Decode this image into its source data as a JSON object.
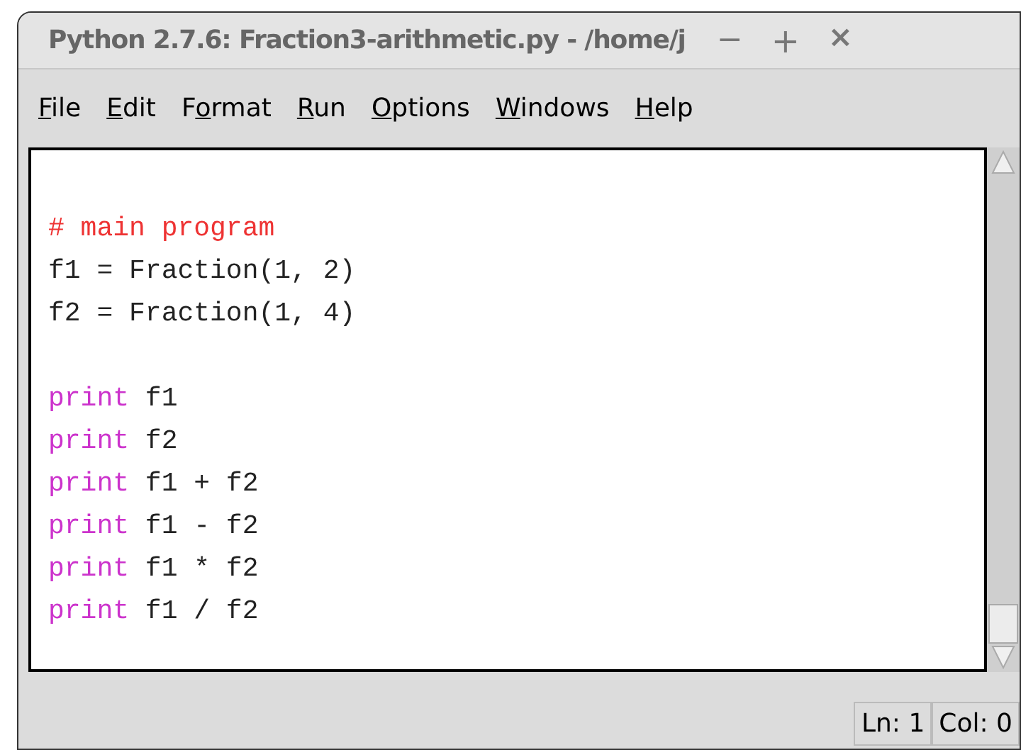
{
  "window": {
    "title": "Python 2.7.6: Fraction3-arithmetic.py - /home/j",
    "controls": [
      {
        "kind": "minimize",
        "glyph": "−"
      },
      {
        "kind": "maximize",
        "glyph": "+"
      },
      {
        "kind": "close",
        "glyph": "×"
      }
    ]
  },
  "menu": [
    {
      "key": "F",
      "post": "ile"
    },
    {
      "key": "E",
      "post": "dit"
    },
    {
      "pre": "F",
      "key": "o",
      "post": "rmat"
    },
    {
      "key": "R",
      "post": "un"
    },
    {
      "key": "O",
      "post": "ptions"
    },
    {
      "key": "W",
      "post": "indows"
    },
    {
      "key": "H",
      "post": "elp"
    }
  ],
  "editor": {
    "lines": [
      {
        "kind": "blank"
      },
      {
        "kind": "code",
        "tokens": [
          {
            "kind": "comment",
            "text": "# main program"
          }
        ]
      },
      {
        "kind": "code",
        "tokens": [
          {
            "kind": "plain",
            "text": "f1 = Fraction(1, 2)"
          }
        ]
      },
      {
        "kind": "code",
        "tokens": [
          {
            "kind": "plain",
            "text": "f2 = Fraction(1, 4)"
          }
        ]
      },
      {
        "kind": "blank"
      },
      {
        "kind": "code",
        "tokens": [
          {
            "kind": "keyword",
            "text": "print"
          },
          {
            "kind": "plain",
            "text": " f1"
          }
        ]
      },
      {
        "kind": "code",
        "tokens": [
          {
            "kind": "keyword",
            "text": "print"
          },
          {
            "kind": "plain",
            "text": " f2"
          }
        ]
      },
      {
        "kind": "code",
        "tokens": [
          {
            "kind": "keyword",
            "text": "print"
          },
          {
            "kind": "plain",
            "text": " f1 + f2"
          }
        ]
      },
      {
        "kind": "code",
        "tokens": [
          {
            "kind": "keyword",
            "text": "print"
          },
          {
            "kind": "plain",
            "text": " f1 - f2"
          }
        ]
      },
      {
        "kind": "code",
        "tokens": [
          {
            "kind": "keyword",
            "text": "print"
          },
          {
            "kind": "plain",
            "text": " f1 * f2"
          }
        ]
      },
      {
        "kind": "code",
        "tokens": [
          {
            "kind": "keyword",
            "text": "print"
          },
          {
            "kind": "plain",
            "text": " f1 / f2"
          }
        ]
      }
    ]
  },
  "status_bar": {
    "line": "Ln: 1",
    "column": "Col: 0"
  }
}
